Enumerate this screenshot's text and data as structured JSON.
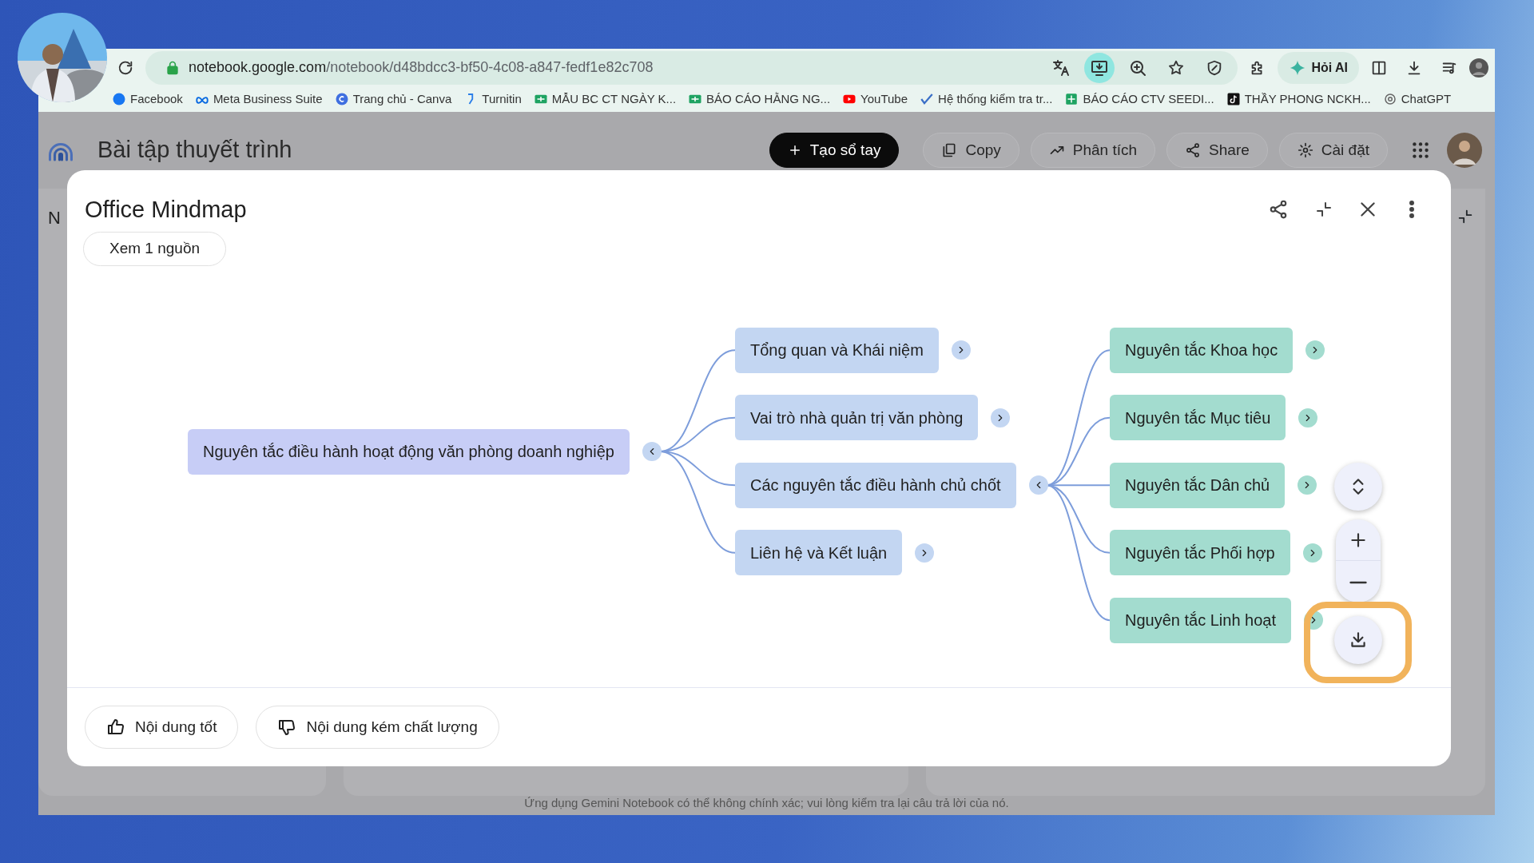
{
  "browser": {
    "url_host": "notebook.google.com",
    "url_path": "/notebook/d48bdcc3-bf50-4c08-a847-fedf1e82c708",
    "ai_button": "Hỏi AI"
  },
  "bookmarks": [
    {
      "label": "Facebook"
    },
    {
      "label": "Meta Business Suite"
    },
    {
      "label": "Trang chủ - Canva"
    },
    {
      "label": "Turnitin"
    },
    {
      "label": "MẪU BC CT NGÀY K..."
    },
    {
      "label": "BÁO CÁO HẰNG NG..."
    },
    {
      "label": "YouTube"
    },
    {
      "label": "Hệ thống kiểm tra tr..."
    },
    {
      "label": "BÁO CÁO CTV SEEDI..."
    },
    {
      "label": "THẦY PHONG NCKH..."
    },
    {
      "label": "ChatGPT"
    }
  ],
  "app": {
    "title": "Bài tập thuyết trình",
    "buttons": [
      "Tạo sổ tay",
      "Copy",
      "Phân tích",
      "Share",
      "Cài đặt"
    ],
    "left_panel_text": "N"
  },
  "modal": {
    "title": "Office Mindmap",
    "source_button": "Xem 1 nguồn",
    "mindmap": {
      "label": "Nguyên tắc điều hành hoạt động văn phòng doanh nghiệp",
      "expanded": true,
      "children": [
        {
          "label": "Tổng quan và Khái niệm",
          "expanded": false
        },
        {
          "label": "Vai trò nhà quản trị văn phòng",
          "expanded": false
        },
        {
          "label": "Các nguyên tắc điều hành chủ chốt",
          "expanded": true,
          "children": [
            {
              "label": "Nguyên tắc Khoa học",
              "expanded": false
            },
            {
              "label": "Nguyên tắc Mục tiêu",
              "expanded": false
            },
            {
              "label": "Nguyên tắc Dân chủ",
              "expanded": false
            },
            {
              "label": "Nguyên tắc Phối hợp",
              "expanded": false
            },
            {
              "label": "Nguyên tắc Linh hoạt",
              "expanded": false
            }
          ]
        },
        {
          "label": "Liên hệ và Kết luận",
          "expanded": false
        }
      ]
    },
    "feedback": [
      "Nội dung tốt",
      "Nội dung kém chất lượng"
    ]
  },
  "footer": "Ứng dụng Gemini Notebook có thể không chính xác; vui lòng kiểm tra lại câu trả lời của nó."
}
